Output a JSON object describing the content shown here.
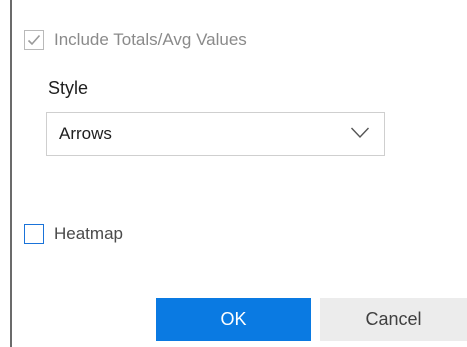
{
  "options": {
    "totals": {
      "label": "Include Totals/Avg Values",
      "checked": true,
      "disabled": true,
      "icon": "checkmark-icon"
    },
    "style": {
      "label": "Style",
      "selected": "Arrows",
      "icon": "chevron-down-icon"
    },
    "heatmap": {
      "label": "Heatmap",
      "checked": false
    }
  },
  "buttons": {
    "ok_label": "OK",
    "cancel_label": "Cancel"
  },
  "colors": {
    "primary": "#0a7ae2",
    "checkbox_border": "#1a73d9",
    "disabled_text": "#8a8a8a",
    "secondary_button": "#ececec"
  }
}
